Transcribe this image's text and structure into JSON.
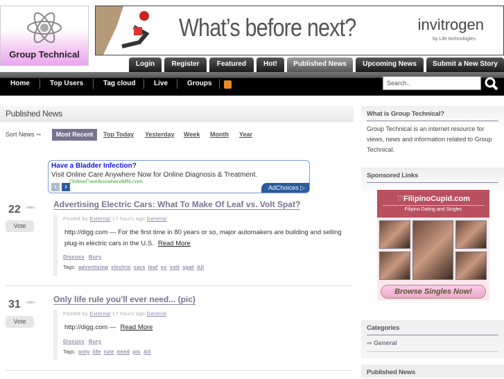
{
  "logo": {
    "text": "Group Technical"
  },
  "banner": {
    "headline": "What’s before next?",
    "brand": "invitrogen",
    "brand_sub": "by Life technologies"
  },
  "tabs": [
    {
      "label": "Login"
    },
    {
      "label": "Register"
    },
    {
      "label": "Featured"
    },
    {
      "label": "Hot!"
    },
    {
      "label": "Published News",
      "active": true
    },
    {
      "label": "Upcoming News"
    },
    {
      "label": "Submit a New Story"
    }
  ],
  "nav": {
    "items": [
      "Home",
      "Top Users",
      "Tag cloud",
      "Live",
      "Groups"
    ],
    "search_placeholder": "Search.."
  },
  "main": {
    "heading": "Published News",
    "sort_label": "Sort News",
    "sort": [
      "Most Recent",
      "Top Today",
      "Yesterday",
      "Week",
      "Month",
      "Year"
    ],
    "ad": {
      "title": "Have a Bladder Infection?",
      "text": "Visit Online Care Anywhere Now for Online Diagnosis & Treatment.",
      "url": "OnlineCareAnywhereMN.com",
      "choices": "AdChoices"
    },
    "stories": [
      {
        "votes": "22",
        "votes_label": "votes",
        "vote_btn": "Vote",
        "title": "Advertising Electric Cars: What To Make Of Leaf vs. Volt Spat?",
        "posted_by": "Posted by",
        "author": "External",
        "time": "17 hours ago",
        "category": "General",
        "body": "http://digg.com — For the first time in 80 years or so, major automakers are building and selling plug-in electric cars in the U.S.",
        "read_more": "Read More",
        "discuss": "Discuss",
        "bury": "Bury",
        "tags_label": "Tags:",
        "tags": [
          "advertising",
          "electric",
          "cars",
          "leaf",
          "vs",
          "volt",
          "spat",
          "All"
        ]
      },
      {
        "votes": "31",
        "votes_label": "votes",
        "vote_btn": "Vote",
        "title": "Only life rule you'll ever need... (pic)",
        "posted_by": "Posted by",
        "author": "External",
        "time": "17 hours ago",
        "category": "General",
        "body": "http://digg.com —",
        "read_more": "Read More",
        "discuss": "Discuss",
        "bury": "Bury",
        "tags_label": "Tags:",
        "tags": [
          "only",
          "life",
          "rule",
          "need",
          "pic",
          "All"
        ]
      }
    ]
  },
  "sidebar": {
    "about_title": "What is Group Technical?",
    "about_text": "Group Technical is an internet resource for views, news and information related to Group Technical.",
    "sponsored_title": "Sponsored Links",
    "ad_brand": "FilipinoCupid.com",
    "ad_sub": "Filipino Dating and Singles",
    "ad_button": "Browse Singles Now!",
    "categories_title": "Categories",
    "categories": [
      "General"
    ],
    "published_title": "Published News"
  }
}
